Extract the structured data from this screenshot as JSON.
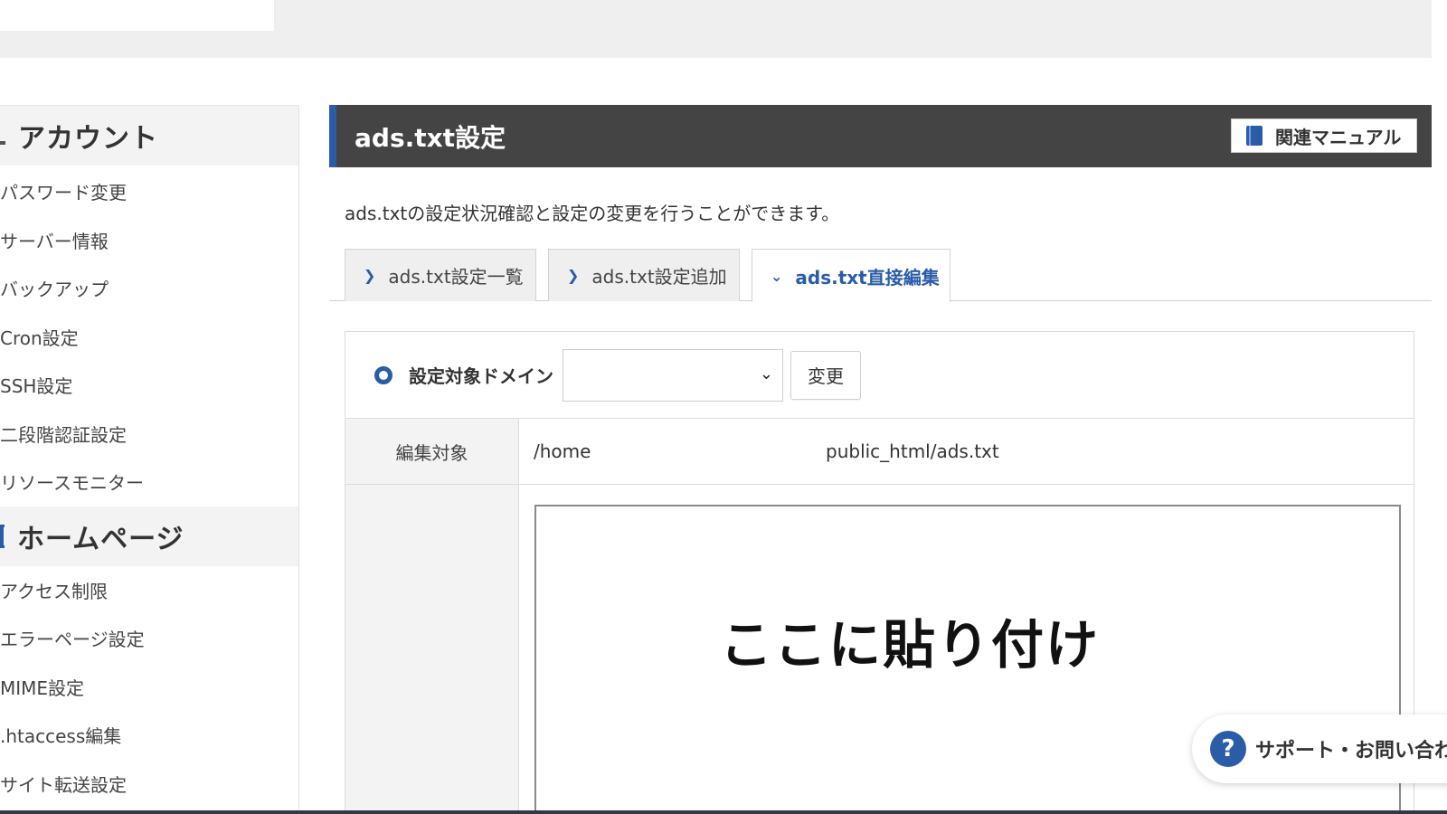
{
  "sidebar": {
    "account": {
      "heading": "アカウント",
      "items": [
        "パスワード変更",
        "サーバー情報",
        "バックアップ",
        "Cron設定",
        "SSH設定",
        "二段階認証設定",
        "リソースモニター"
      ]
    },
    "homepage": {
      "heading": "ホームページ",
      "items": [
        "アクセス制限",
        "エラーページ設定",
        "MIME設定",
        ".htaccess編集",
        "サイト転送設定"
      ]
    }
  },
  "main": {
    "title": "ads.txt設定",
    "manual_label": "関連マニュアル",
    "description": "ads.txtの設定状況確認と設定の変更を行うことができます。",
    "tabs": [
      {
        "label": "ads.txt設定一覧",
        "active": false
      },
      {
        "label": "ads.txt設定追加",
        "active": false
      },
      {
        "label": "ads.txt直接編集",
        "active": true
      }
    ],
    "domain_label": "設定対象ドメイン",
    "domain_value": "",
    "change_label": "変更",
    "edit_target_label": "編集対象",
    "path_prefix": "/home",
    "path_suffix": "public_html/ads.txt",
    "paste_note": "ここに貼り付け"
  },
  "support": {
    "icon": "?",
    "label": "サポート・お問い合わせ"
  },
  "colors": {
    "accent": "#2a5ca8",
    "header_bg": "#444444"
  }
}
